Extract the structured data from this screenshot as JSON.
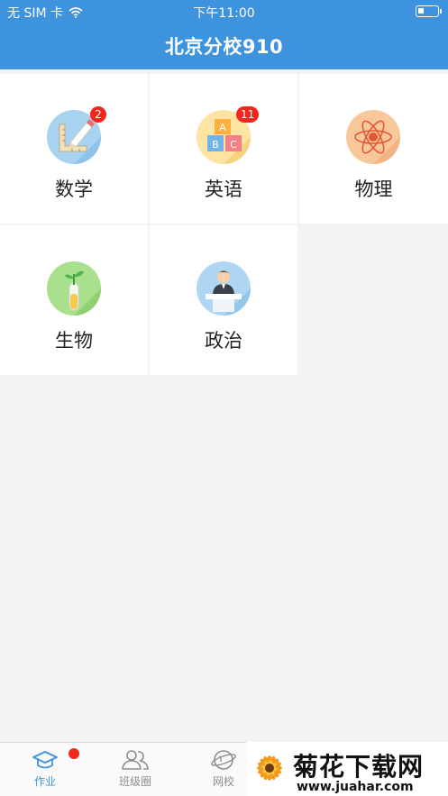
{
  "status_bar": {
    "carrier": "无 SIM 卡",
    "time": "下午11:00"
  },
  "nav": {
    "title": "北京分校910"
  },
  "subjects": [
    {
      "label": "数学",
      "icon": "math-ruler-pencil-icon",
      "badge": "2"
    },
    {
      "label": "英语",
      "icon": "abc-blocks-icon",
      "badge": "11"
    },
    {
      "label": "物理",
      "icon": "atom-icon",
      "badge": ""
    },
    {
      "label": "生物",
      "icon": "plant-test-tube-icon",
      "badge": ""
    },
    {
      "label": "政治",
      "icon": "speaker-podium-icon",
      "badge": ""
    }
  ],
  "tabbar": {
    "tabs": [
      {
        "label": "作业",
        "icon": "graduation-cap-icon",
        "active": true
      },
      {
        "label": "班级圈",
        "icon": "people-icon",
        "active": false
      },
      {
        "label": "网校",
        "icon": "globe-icon",
        "active": false
      }
    ]
  },
  "watermark": {
    "title": "菊花下载网",
    "url": "www.juahar.com"
  },
  "colors": {
    "primary": "#3d93dd",
    "badge": "#f2271c",
    "background": "#f1f3f5"
  }
}
